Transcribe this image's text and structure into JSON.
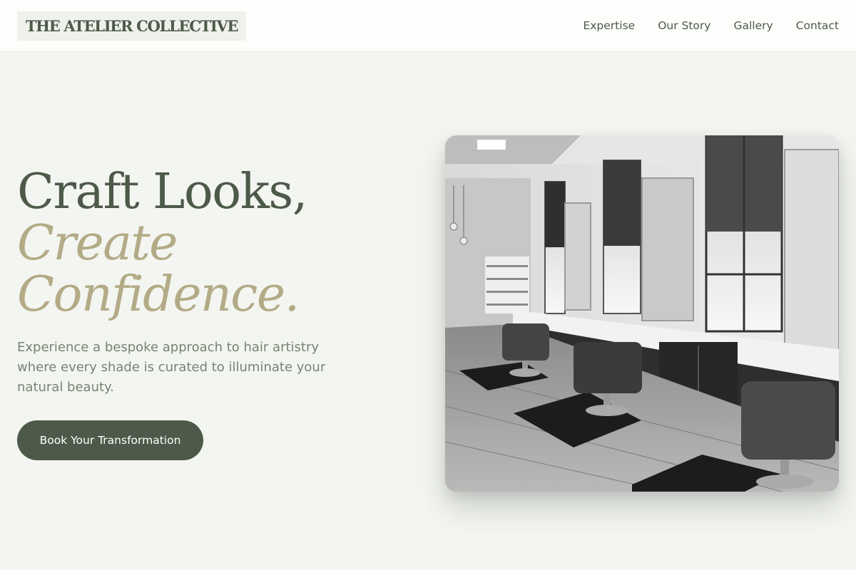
{
  "header": {
    "logo": "THE ATELIER COLLECTIVE",
    "nav": [
      "Expertise",
      "Our Story",
      "Gallery",
      "Contact"
    ]
  },
  "hero": {
    "title_line1": "Craft Looks,",
    "title_line2": "Create",
    "title_line3": "Confidence.",
    "subtitle": "Experience a bespoke approach to hair artistry where every shade is curated to illuminate your natural beauty.",
    "cta_label": "Book Your Transformation",
    "image_subject": "black-and-white photo of a salon interior with styling chairs, mirrors and tall windows"
  },
  "colors": {
    "page_background": "#f3f5f1",
    "header_background": "#fdfefc",
    "primary_green": "#4d5a49",
    "accent_gold": "#b3ab86",
    "body_text": "#768372"
  }
}
